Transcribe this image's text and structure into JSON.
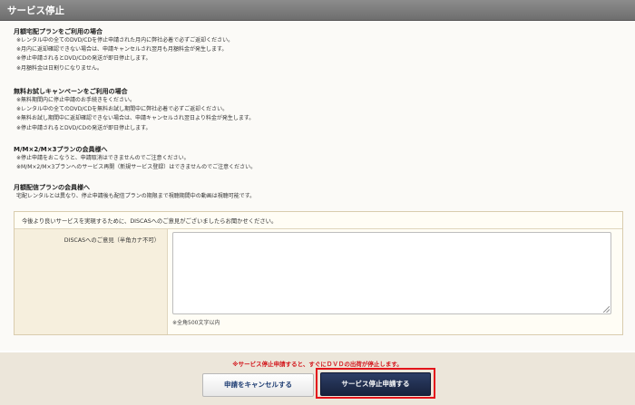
{
  "header": {
    "title": "サービス停止"
  },
  "sections": [
    {
      "title": "月額宅配プランをご利用の場合",
      "lines": [
        "※レンタル中の全てのDVD/CDを停止申請された月内に弊社必着で必ずご返却ください。",
        "※月内に返却確認できない場合は、申請キャンセルされ翌月も月額料金が発生します。",
        "※停止申請されるとDVD/CDの発送が即日停止します。",
        "※月額料金は日割りになりません。"
      ]
    },
    {
      "title": "無料お試しキャンペーンをご利用の場合",
      "lines": [
        "※無料期間内に停止申請のお手続きをください。",
        "※レンタル中の全てのDVD/CDを無料お試し期間中に弊社必着で必ずご返却ください。",
        "※無料お試し期間中に返却確認できない場合は、申請キャンセルされ翌日より料金が発生します。",
        "※停止申請されるとDVD/CDの発送が即日停止します。"
      ]
    },
    {
      "title": "M/M×2/M×3プランの会員様へ",
      "lines": [
        "※停止申請をおこなうと、申請取消はできませんのでご注意ください。",
        "※M/M×2/M×3プランへのサービス再開（新規サービス登録）はできませんのでご注意ください。"
      ]
    },
    {
      "title": "月額配信プランの会員様へ",
      "lines": [
        "宅配レンタルとは異なり、停止申請後も配信プランの期限まで視聴期間中の動画は視聴可能です。"
      ]
    }
  ],
  "form": {
    "intro": "今後より良いサービスを実現するために、DISCASへのご意見がございましたらお聞かせください。",
    "label": "DISCASへのご意見（半角カナ不可）",
    "value": "",
    "limit_note": "※全角500文字以内"
  },
  "footer": {
    "warning": "※サービス停止申請すると、すぐにＤＶＤの出荷が停止します。",
    "cancel_label": "申請をキャンセルする",
    "submit_label": "サービス停止申請する"
  },
  "colors": {
    "warning": "#d2141a",
    "submit_button": "#1f2b4a",
    "highlight_border": "#e3151b"
  }
}
